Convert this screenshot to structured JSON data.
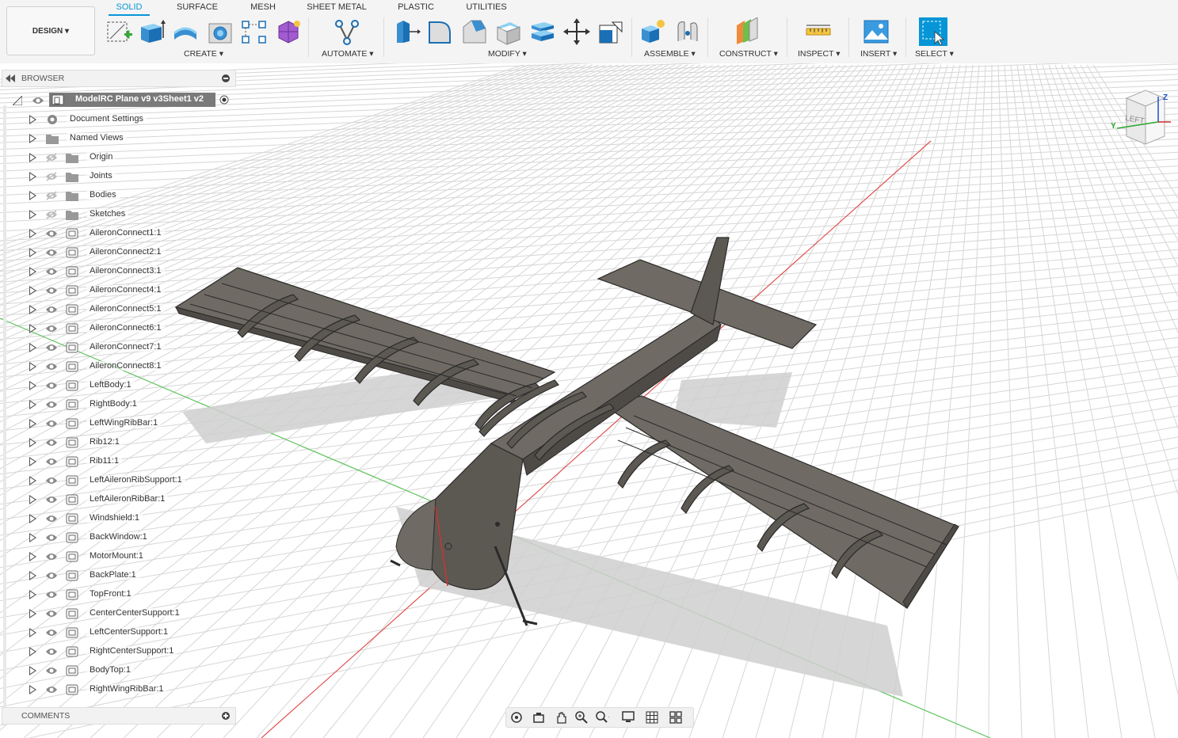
{
  "workspace": {
    "label": "DESIGN ▾"
  },
  "tabs": [
    "SOLID",
    "SURFACE",
    "MESH",
    "SHEET METAL",
    "PLASTIC",
    "UTILITIES"
  ],
  "groups": {
    "create": "CREATE ▾",
    "automate": "AUTOMATE ▾",
    "modify": "MODIFY ▾",
    "assemble": "ASSEMBLE ▾",
    "construct": "CONSTRUCT ▾",
    "inspect": "INSPECT ▾",
    "insert": "INSERT ▾",
    "select": "SELECT ▾"
  },
  "browser": {
    "title": "BROWSER",
    "root": "ModelRC Plane v9 v3Sheet1 v2",
    "items": [
      "Document Settings",
      "Named Views",
      "Origin",
      "Joints",
      "Bodies",
      "Sketches",
      "AileronConnect1:1",
      "AileronConnect2:1",
      "AileronConnect3:1",
      "AileronConnect4:1",
      "AileronConnect5:1",
      "AileronConnect6:1",
      "AileronConnect7:1",
      "AileronConnect8:1",
      "LeftBody:1",
      "RightBody:1",
      "LeftWingRibBar:1",
      "Rib12:1",
      "Rib11:1",
      "LeftAileronRibSupport:1",
      "LeftAileronRibBar:1",
      "Windshield:1",
      "BackWindow:1",
      "MotorMount:1",
      "BackPlate:1",
      "TopFront:1",
      "CenterCenterSupport:1",
      "LeftCenterSupport:1",
      "RightCenterSupport:1",
      "BodyTop:1",
      "RightWingRibBar:1"
    ]
  },
  "comments": {
    "title": "COMMENTS"
  },
  "viewcube": {
    "face": "LEFT",
    "axis_z": "Z",
    "axis_y": "Y"
  },
  "colors": {
    "accent": "#0696d7",
    "model": "#6f6a63",
    "edge": "#2b2b2b"
  }
}
